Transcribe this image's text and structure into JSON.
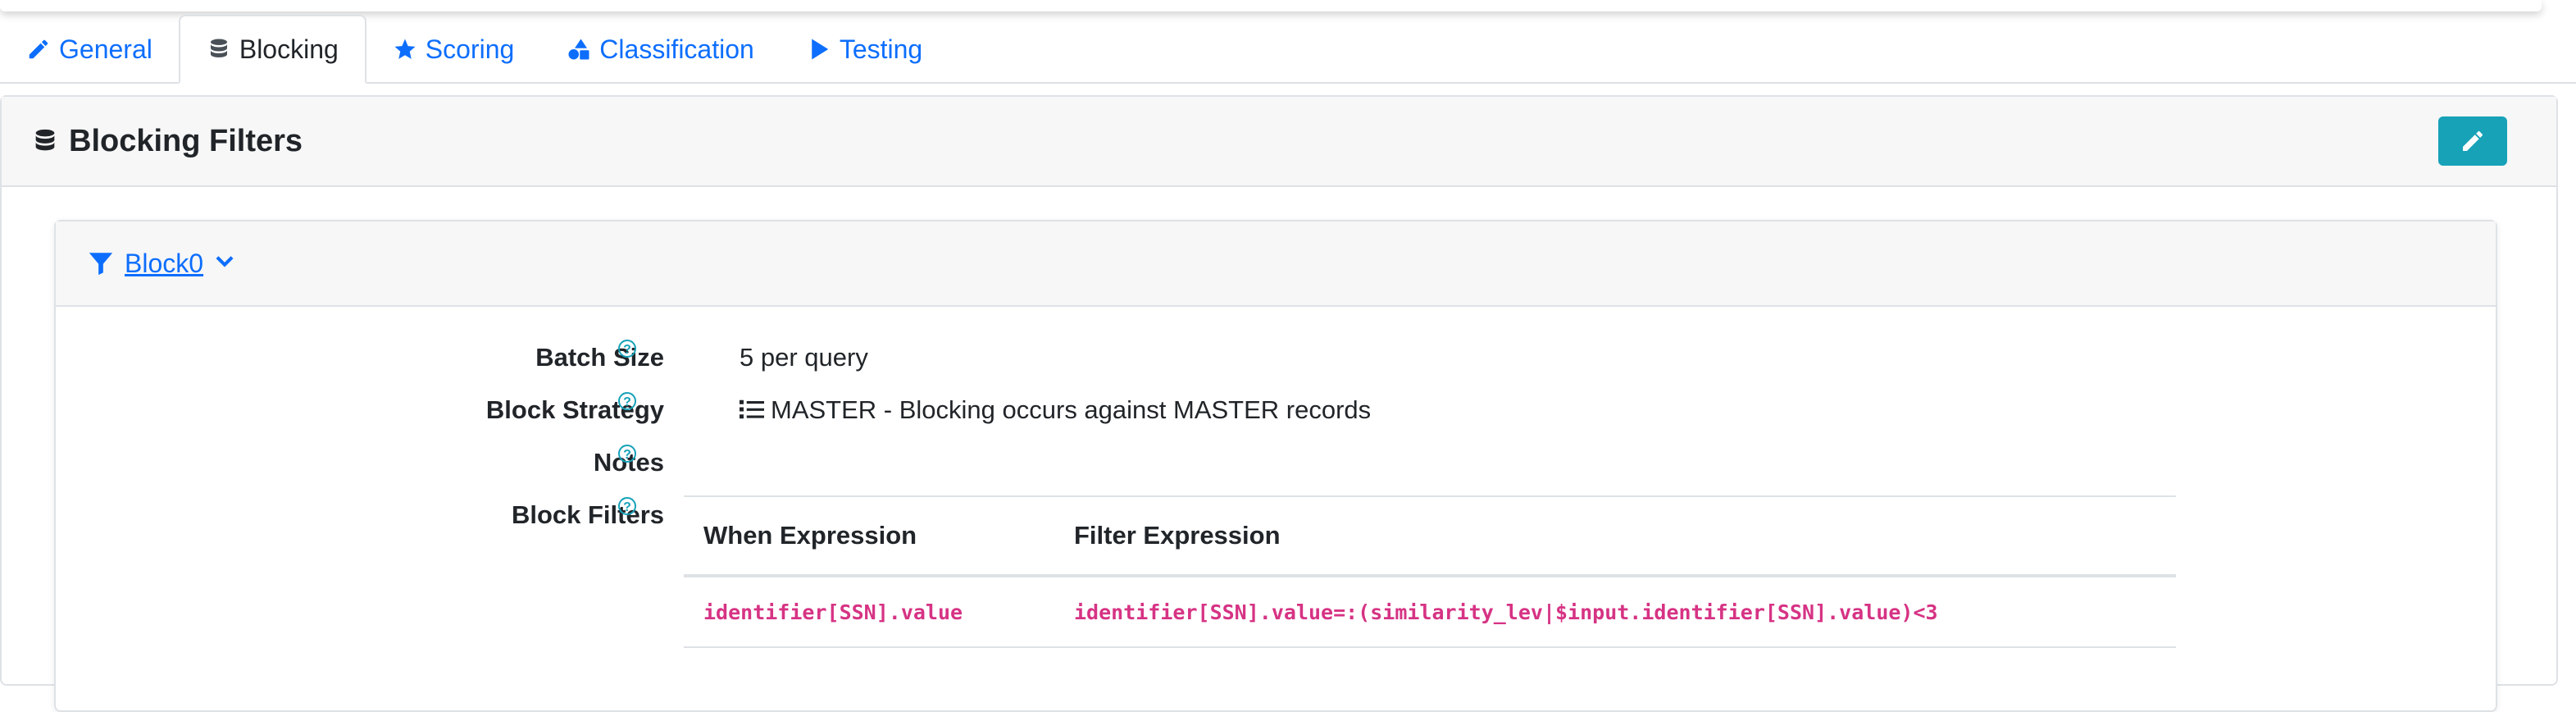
{
  "tabs": [
    {
      "label": "General",
      "icon": "pencil-icon",
      "active": false
    },
    {
      "label": "Blocking",
      "icon": "database-icon",
      "active": true
    },
    {
      "label": "Scoring",
      "icon": "star-icon",
      "active": false
    },
    {
      "label": "Classification",
      "icon": "shapes-icon",
      "active": false
    },
    {
      "label": "Testing",
      "icon": "play-icon",
      "active": false
    }
  ],
  "card": {
    "title": "Blocking Filters",
    "edit_icon": "pencil-icon"
  },
  "block": {
    "name": "Block0",
    "fields": {
      "batch_size_label": "Batch Size",
      "batch_size_value": "5 per query",
      "strategy_label": "Block Strategy",
      "strategy_value": "MASTER - Blocking occurs against MASTER records",
      "notes_label": "Notes",
      "filters_label": "Block Filters"
    },
    "table": {
      "headers": [
        "When Expression",
        "Filter Expression"
      ],
      "rows": [
        [
          "identifier[SSN].value",
          "identifier[SSN].value=:(similarity_lev|$input.identifier[SSN].value)<3"
        ]
      ]
    }
  },
  "colors": {
    "link": "#0d6efd",
    "edit_button": "#17a2b8",
    "code": "#d63384"
  }
}
